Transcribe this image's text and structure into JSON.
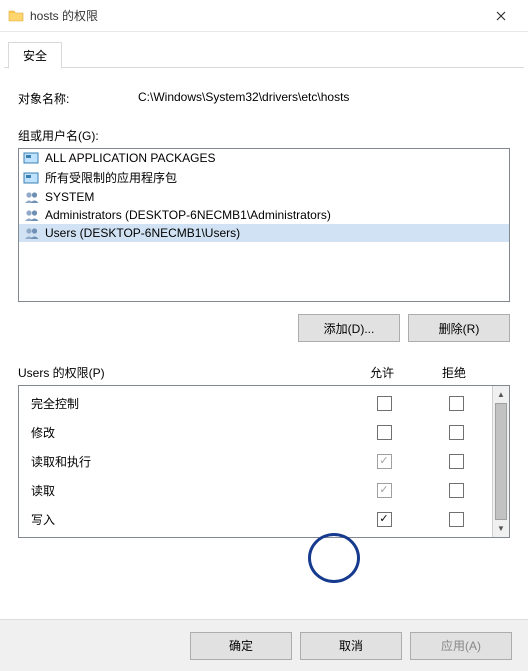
{
  "titlebar": {
    "title": "hosts 的权限"
  },
  "tabs": {
    "security": "安全"
  },
  "object": {
    "label": "对象名称:",
    "value": "C:\\Windows\\System32\\drivers\\etc\\hosts"
  },
  "groups": {
    "label": "组或用户名(G):",
    "items": [
      {
        "name": "ALL APPLICATION PACKAGES",
        "icon": "pkg"
      },
      {
        "name": "所有受限制的应用程序包",
        "icon": "pkg"
      },
      {
        "name": "SYSTEM",
        "icon": "users"
      },
      {
        "name": "Administrators (DESKTOP-6NECMB1\\Administrators)",
        "icon": "users"
      },
      {
        "name": "Users (DESKTOP-6NECMB1\\Users)",
        "icon": "users"
      }
    ]
  },
  "buttons": {
    "add": "添加(D)...",
    "remove": "删除(R)",
    "ok": "确定",
    "cancel": "取消",
    "apply": "应用(A)"
  },
  "perms": {
    "header_label": "Users 的权限(P)",
    "allow_label": "允许",
    "deny_label": "拒绝",
    "rows": [
      {
        "name": "完全控制",
        "allow": "",
        "deny": ""
      },
      {
        "name": "修改",
        "allow": "",
        "deny": ""
      },
      {
        "name": "读取和执行",
        "allow": "gray",
        "deny": ""
      },
      {
        "name": "读取",
        "allow": "gray",
        "deny": ""
      },
      {
        "name": "写入",
        "allow": "black",
        "deny": ""
      }
    ]
  }
}
